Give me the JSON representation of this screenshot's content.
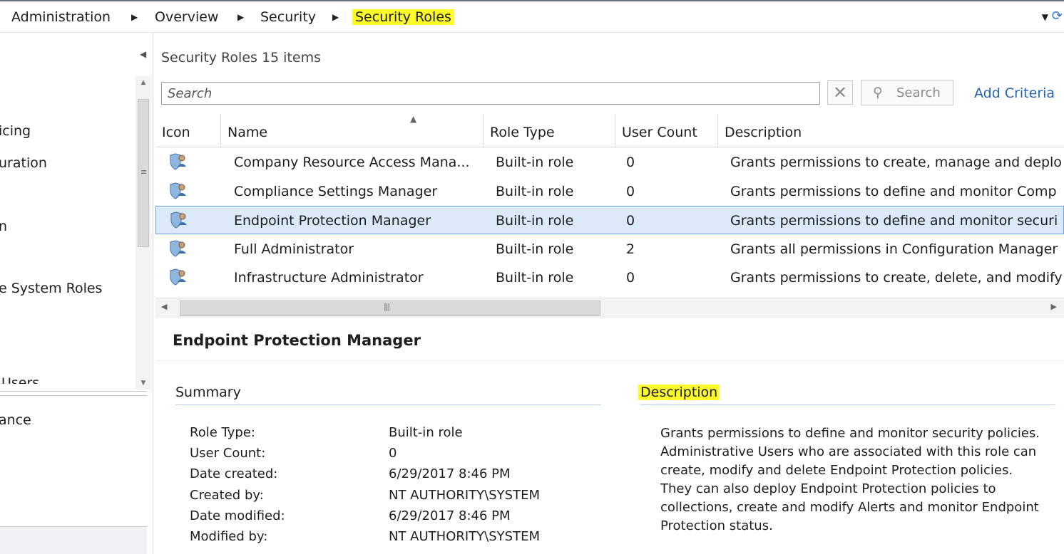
{
  "breadcrumb": {
    "items": [
      "Administration",
      "Overview",
      "Security",
      "Security Roles"
    ]
  },
  "nav": {
    "items": [
      "icing",
      "uration",
      "n",
      "e System Roles",
      "Users",
      "ance"
    ]
  },
  "list": {
    "title": "Security Roles 15 items",
    "search_placeholder": "Search",
    "search_button": "Search",
    "add_criteria": "Add Criteria",
    "columns": [
      "Icon",
      "Name",
      "Role Type",
      "User Count",
      "Description"
    ],
    "rows": [
      {
        "name": "Company Resource Access Mana...",
        "role_type": "Built-in role",
        "user_count": "0",
        "description": "Grants permissions to create, manage and deplo"
      },
      {
        "name": "Compliance Settings Manager",
        "role_type": "Built-in role",
        "user_count": "0",
        "description": "Grants permissions to define and monitor Comp"
      },
      {
        "name": "Endpoint Protection Manager",
        "role_type": "Built-in role",
        "user_count": "0",
        "description": "Grants permissions to define and monitor securi",
        "selected": true
      },
      {
        "name": "Full Administrator",
        "role_type": "Built-in role",
        "user_count": "2",
        "description": "Grants all permissions in Configuration Manager"
      },
      {
        "name": "Infrastructure Administrator",
        "role_type": "Built-in role",
        "user_count": "0",
        "description": "Grants permissions to create, delete, and modify"
      }
    ]
  },
  "detail": {
    "title": "Endpoint Protection Manager",
    "summary_heading": "Summary",
    "description_heading": "Description",
    "summary": [
      {
        "label": "Role Type:",
        "value": "Built-in role"
      },
      {
        "label": "User Count:",
        "value": "0"
      },
      {
        "label": "Date created:",
        "value": "6/29/2017 8:46 PM"
      },
      {
        "label": "Created by:",
        "value": "NT AUTHORITY\\SYSTEM"
      },
      {
        "label": "Date modified:",
        "value": "6/29/2017 8:46 PM"
      },
      {
        "label": "Modified by:",
        "value": "NT AUTHORITY\\SYSTEM"
      }
    ],
    "description": "Grants permissions to define and monitor security policies. Administrative Users who are associated with this role can create, modify and delete Endpoint Protection policies. They can also deploy Endpoint Protection policies to collections, create and modify Alerts and monitor Endpoint Protection status."
  },
  "icons": {
    "crumb_separator": "right-triangle-icon",
    "dropdown": "dropdown-arrow-icon",
    "refresh": "refresh-icon",
    "role": "security-role-icon",
    "clear": "close-icon",
    "search": "magnifier-icon"
  },
  "colors": {
    "highlight": "#fdfb2a",
    "link": "#2463b5",
    "selected_row": "#dce9f8"
  }
}
